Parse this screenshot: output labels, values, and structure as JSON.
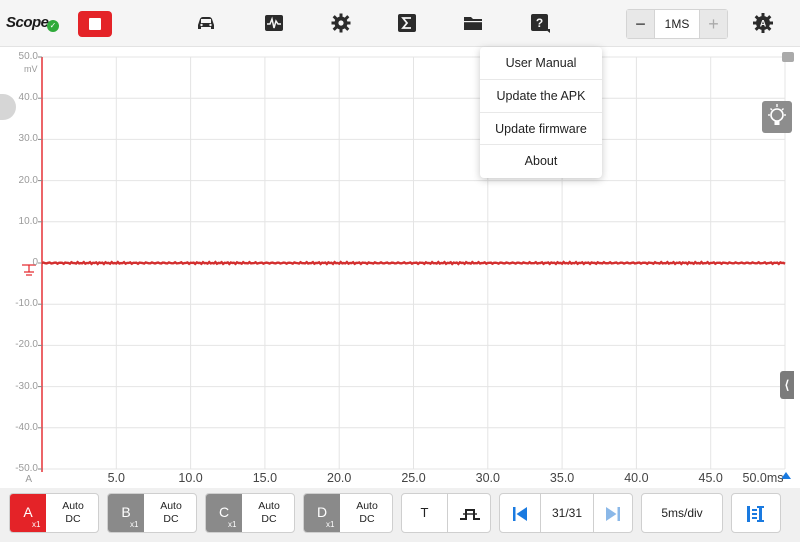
{
  "app": {
    "title": "Scope"
  },
  "toolbar": {
    "icons": [
      "stop-icon",
      "vehicle-icon",
      "waveform-icon",
      "gear-icon",
      "sigma-icon",
      "folder-icon",
      "help-icon",
      "auto-settings-icon"
    ],
    "timebase": {
      "minus": "−",
      "value": "1MS",
      "plus": "+"
    }
  },
  "help_menu": {
    "items": [
      "User Manual",
      "Update the APK",
      "Update firmware",
      "About"
    ]
  },
  "colors": {
    "channel_a": "#e42328",
    "accent_blue": "#1a7ae0",
    "stop": "#e42328",
    "gray_channel": "#8a8a8a"
  },
  "chart_data": {
    "type": "line",
    "ylabel": "mV",
    "yticks": [
      "50.0",
      "40.0",
      "30.0",
      "20.0",
      "10.0",
      "0",
      "-10.0",
      "-20.0",
      "-30.0",
      "-40.0",
      "-50.0"
    ],
    "xticks": [
      "5.0",
      "10.0",
      "15.0",
      "20.0",
      "25.0",
      "30.0",
      "35.0",
      "40.0",
      "45.0",
      "50.0ms"
    ],
    "xlim": [
      0,
      50
    ],
    "ylim": [
      -50,
      50
    ],
    "grid": true,
    "series": [
      {
        "values_constant": 0,
        "color": "#d32f2f"
      }
    ],
    "channel_marker": "A"
  },
  "channels": [
    {
      "letter": "A",
      "scale": "x1",
      "mode_top": "Auto",
      "mode_bottom": "DC",
      "color": "#e42328"
    },
    {
      "letter": "B",
      "scale": "x1",
      "mode_top": "Auto",
      "mode_bottom": "DC",
      "color": "#8a8a8a"
    },
    {
      "letter": "C",
      "scale": "x1",
      "mode_top": "Auto",
      "mode_bottom": "DC",
      "color": "#8a8a8a"
    },
    {
      "letter": "D",
      "scale": "x1",
      "mode_top": "Auto",
      "mode_bottom": "DC",
      "color": "#8a8a8a"
    }
  ],
  "bottom": {
    "trigger_label": "T",
    "page_counter": "31/31",
    "time_per_div": "5ms/div"
  }
}
